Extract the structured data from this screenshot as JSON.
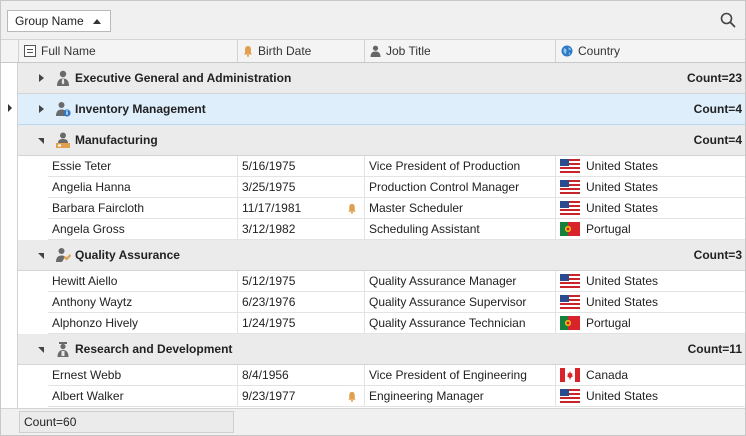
{
  "group_panel": {
    "group_chip_label": "Group Name"
  },
  "columns": [
    {
      "label": "Full Name",
      "icon": "name-column-icon"
    },
    {
      "label": "Birth Date",
      "icon": "bell-icon"
    },
    {
      "label": "Job Title",
      "icon": "person-icon"
    },
    {
      "label": "Country",
      "icon": "globe-icon"
    }
  ],
  "groups": [
    {
      "title": "Executive General and Administration",
      "count": "Count=23",
      "state": "collapsed",
      "icon": "executive-icon",
      "selected": false,
      "rows": []
    },
    {
      "title": "Inventory Management",
      "count": "Count=4",
      "state": "collapsed",
      "icon": "inventory-icon",
      "selected": true,
      "rows": []
    },
    {
      "title": "Manufacturing",
      "count": "Count=4",
      "state": "expanded",
      "icon": "manufacturing-icon",
      "selected": false,
      "rows": [
        {
          "name": "Essie Teter",
          "birth": "5/16/1975",
          "reminder": false,
          "job": "Vice President of Production",
          "country": "United States",
          "flag": "us"
        },
        {
          "name": "Angelia Hanna",
          "birth": "3/25/1975",
          "reminder": false,
          "job": "Production Control Manager",
          "country": "United States",
          "flag": "us"
        },
        {
          "name": "Barbara Faircloth",
          "birth": "11/17/1981",
          "reminder": true,
          "job": "Master Scheduler",
          "country": "United States",
          "flag": "us"
        },
        {
          "name": "Angela Gross",
          "birth": "3/12/1982",
          "reminder": false,
          "job": "Scheduling Assistant",
          "country": "Portugal",
          "flag": "pt"
        }
      ]
    },
    {
      "title": "Quality Assurance",
      "count": "Count=3",
      "state": "expanded",
      "icon": "quality-icon",
      "selected": false,
      "rows": [
        {
          "name": "Hewitt Aiello",
          "birth": "5/12/1975",
          "reminder": false,
          "job": "Quality Assurance Manager",
          "country": "United States",
          "flag": "us"
        },
        {
          "name": "Anthony Waytz",
          "birth": "6/23/1976",
          "reminder": false,
          "job": "Quality Assurance Supervisor",
          "country": "United States",
          "flag": "us"
        },
        {
          "name": "Alphonzo Hively",
          "birth": "1/24/1975",
          "reminder": false,
          "job": "Quality Assurance Technician",
          "country": "Portugal",
          "flag": "pt"
        }
      ]
    },
    {
      "title": "Research and Development",
      "count": "Count=11",
      "state": "expanded",
      "icon": "research-icon",
      "selected": false,
      "rows": [
        {
          "name": "Ernest Webb",
          "birth": "8/4/1956",
          "reminder": false,
          "job": "Vice President of Engineering",
          "country": "Canada",
          "flag": "ca"
        },
        {
          "name": "Albert Walker",
          "birth": "9/23/1977",
          "reminder": true,
          "job": "Engineering Manager",
          "country": "United States",
          "flag": "us"
        }
      ]
    }
  ],
  "footer": {
    "summary": "Count=60"
  },
  "colors": {
    "selected_group": "#deeefa",
    "group_row": "#ebebeb",
    "bell": "#e0a050",
    "accent_blue": "#2f78c4"
  }
}
